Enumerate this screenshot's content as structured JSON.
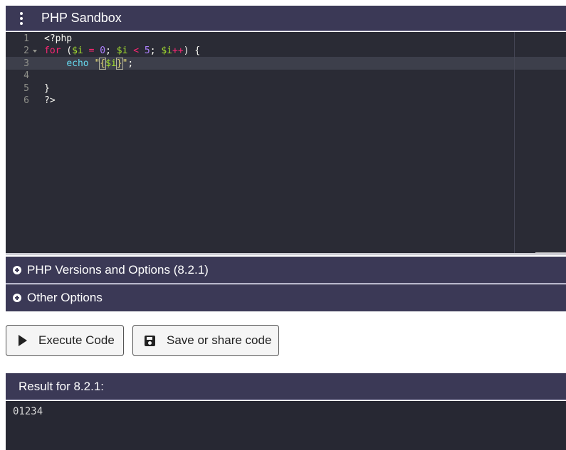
{
  "app": {
    "title": "PHP Sandbox"
  },
  "editor": {
    "line_numbers": [
      "1",
      "2",
      "3",
      "4",
      "5",
      "6"
    ],
    "lines": [
      {
        "tokens": [
          {
            "t": "<?php",
            "c": "plain"
          }
        ]
      },
      {
        "tokens": [
          {
            "t": "for",
            "c": "kw"
          },
          {
            "t": " (",
            "c": "plain"
          },
          {
            "t": "$i",
            "c": "var"
          },
          {
            "t": " ",
            "c": "plain"
          },
          {
            "t": "=",
            "c": "op"
          },
          {
            "t": " ",
            "c": "plain"
          },
          {
            "t": "0",
            "c": "num"
          },
          {
            "t": "; ",
            "c": "plain"
          },
          {
            "t": "$i",
            "c": "var"
          },
          {
            "t": " ",
            "c": "plain"
          },
          {
            "t": "<",
            "c": "op"
          },
          {
            "t": " ",
            "c": "plain"
          },
          {
            "t": "5",
            "c": "num"
          },
          {
            "t": "; ",
            "c": "plain"
          },
          {
            "t": "$i",
            "c": "var"
          },
          {
            "t": "++",
            "c": "op"
          },
          {
            "t": ") {",
            "c": "plain"
          }
        ]
      },
      {
        "tokens": [
          {
            "t": "    ",
            "c": "plain"
          },
          {
            "t": "echo",
            "c": "fn"
          },
          {
            "t": " ",
            "c": "plain"
          },
          {
            "t": "\"",
            "c": "str"
          },
          {
            "t": "{",
            "c": "str brk"
          },
          {
            "t": "$i",
            "c": "var"
          },
          {
            "t": "}",
            "c": "str brk"
          },
          {
            "t": "\"",
            "c": "str"
          },
          {
            "t": ";",
            "c": "plain"
          }
        ]
      },
      {
        "tokens": []
      },
      {
        "tokens": [
          {
            "t": "}",
            "c": "plain"
          }
        ]
      },
      {
        "tokens": [
          {
            "t": "?>",
            "c": "plain"
          }
        ]
      }
    ]
  },
  "options": {
    "php_versions_label": "PHP Versions and Options (8.2.1)",
    "other_label": "Other Options"
  },
  "buttons": {
    "execute_label": "Execute Code",
    "save_label": "Save or share code"
  },
  "result": {
    "header": "Result for 8.2.1:",
    "output": "01234"
  },
  "colors": {
    "header_bg": "#3b3956",
    "editor_bg": "#2a2b35",
    "keyword": "#f92672",
    "variable": "#a6e22e",
    "number": "#ae81ff",
    "function": "#66d9ef",
    "string": "#e6db74"
  }
}
